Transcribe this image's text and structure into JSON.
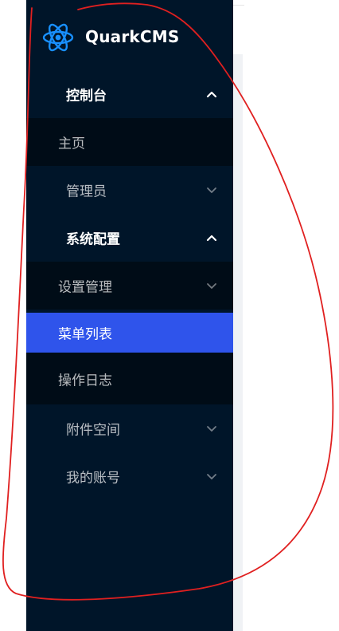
{
  "brand": {
    "name": "QuarkCMS",
    "logo_icon": "atom-icon",
    "logo_color": "#1890ff"
  },
  "colors": {
    "sidebar_bg": "#001529",
    "submenu_bg": "#000c17",
    "active_bg": "#2f54eb",
    "annotation": "#e02020"
  },
  "menu": {
    "dashboard": {
      "label": "控制台",
      "expanded": true,
      "icon": "chevron-up-icon"
    },
    "home": {
      "label": "主页"
    },
    "admin": {
      "label": "管理员",
      "expanded": false,
      "icon": "chevron-down-icon"
    },
    "system": {
      "label": "系统配置",
      "expanded": true,
      "icon": "chevron-up-icon"
    },
    "settings": {
      "label": "设置管理",
      "expanded": false,
      "icon": "chevron-down-icon"
    },
    "menu_list": {
      "label": "菜单列表",
      "active": true
    },
    "operation_log": {
      "label": "操作日志"
    },
    "attachments": {
      "label": "附件空间",
      "expanded": false,
      "icon": "chevron-down-icon"
    },
    "account": {
      "label": "我的账号",
      "expanded": false,
      "icon": "chevron-down-icon"
    }
  }
}
